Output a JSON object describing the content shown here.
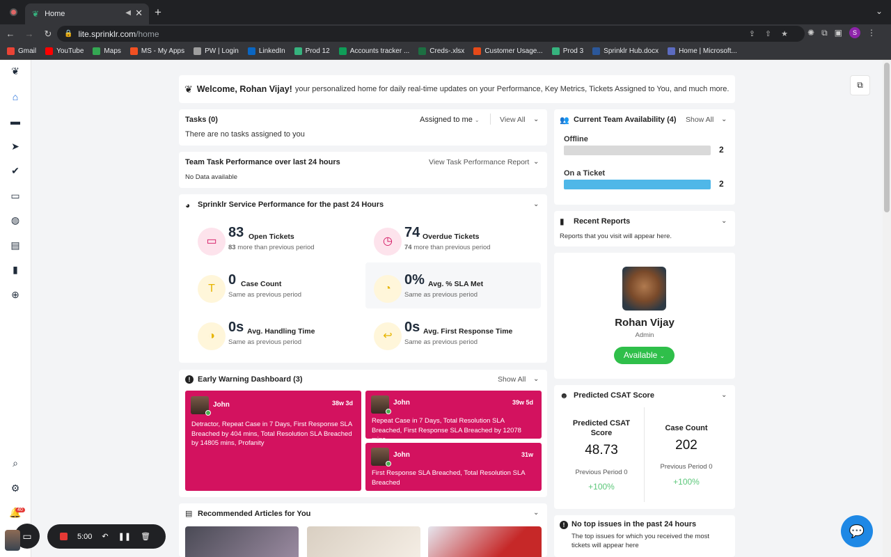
{
  "browser": {
    "tab_title": "Home",
    "url_host": "lite.sprinklr.com",
    "url_path": "/home",
    "profile_initial": "S"
  },
  "bookmarks": [
    {
      "label": "Gmail",
      "color": "#ea4335"
    },
    {
      "label": "YouTube",
      "color": "#ff0000"
    },
    {
      "label": "Maps",
      "color": "#34a853"
    },
    {
      "label": "MS - My Apps",
      "color": "#f25022"
    },
    {
      "label": "PW | Login",
      "color": "#9e9e9e"
    },
    {
      "label": "LinkedIn",
      "color": "#0a66c2"
    },
    {
      "label": "Prod 12",
      "color": "#36b37e"
    },
    {
      "label": "Accounts tracker ...",
      "color": "#0f9d58"
    },
    {
      "label": "Creds-.xlsx",
      "color": "#1d6f42"
    },
    {
      "label": "Customer Usage...",
      "color": "#e64a19"
    },
    {
      "label": "Prod 3",
      "color": "#36b37e"
    },
    {
      "label": "Sprinklr Hub.docx",
      "color": "#2b579a"
    },
    {
      "label": "Home | Microsoft...",
      "color": "#5c6bc0"
    }
  ],
  "welcome": {
    "name": "Welcome, Rohan Vijay!",
    "text": "your personalized home for daily real-time updates on your Performance, Key Metrics, Tickets Assigned to You, and much more."
  },
  "tasks": {
    "title": "Tasks (0)",
    "filter": "Assigned to me",
    "view_all": "View All",
    "empty": "There are no tasks assigned to you"
  },
  "team_task": {
    "title": "Team Task Performance over last 24 hours",
    "report_link": "View Task Performance Report",
    "empty": "No Data available"
  },
  "service": {
    "title": "Sprinklr Service Performance for the past 24 Hours",
    "metrics": [
      {
        "value": "83",
        "label": "Open Tickets",
        "sub_value": "83",
        "sub": "more than previous period"
      },
      {
        "value": "74",
        "label": "Overdue Tickets",
        "sub_value": "74",
        "sub": "more than previous period"
      },
      {
        "value": "0",
        "label": "Case Count",
        "sub": "Same as previous period"
      },
      {
        "value": "0%",
        "label": "Avg. % SLA Met",
        "sub": "Same as previous period"
      },
      {
        "value": "0s",
        "label": "Avg. Handling Time",
        "sub": "Same as previous period"
      },
      {
        "value": "0s",
        "label": "Avg. First Response Time",
        "sub": "Same as previous period"
      }
    ]
  },
  "early_warning": {
    "title": "Early Warning Dashboard (3)",
    "show_all": "Show All",
    "items": [
      {
        "name": "John",
        "age": "38w 3d",
        "text": "Detractor, Repeat Case in 7 Days, First Response SLA Breached by 404 mins, Total Resolution SLA Breached by 14805 mins, Profanity"
      },
      {
        "name": "John",
        "age": "39w 5d",
        "text": "Repeat Case in 7 Days, Total Resolution SLA Breached, First Response SLA Breached by 12078 mins"
      },
      {
        "name": "John",
        "age": "31w",
        "text": "First Response SLA Breached, Total Resolution SLA Breached"
      }
    ]
  },
  "articles": {
    "title": "Recommended Articles for You"
  },
  "availability": {
    "title": "Current Team Availability (4)",
    "show_all": "Show All",
    "rows": [
      {
        "label": "Offline",
        "count": "2",
        "color": "#d9d9d9"
      },
      {
        "label": "On a Ticket",
        "count": "2",
        "color": "#4fb7e8"
      }
    ]
  },
  "recent_reports": {
    "title": "Recent Reports",
    "text": "Reports that you visit will appear here."
  },
  "profile": {
    "name": "Rohan Vijay",
    "role": "Admin",
    "status": "Available",
    "status_color": "#2fbf4a"
  },
  "csat": {
    "title": "Predicted CSAT Score",
    "left_label": "Predicted CSAT Score",
    "left_value": "48.73",
    "left_prev": "Previous Period 0",
    "left_change": "+100%",
    "right_label": "Case Count",
    "right_value": "202",
    "right_prev": "Previous Period 0",
    "right_change": "+100%"
  },
  "top_issues": {
    "title": "No top issues in the past 24 hours",
    "text": "The top issues for which you received the most tickets will appear here"
  },
  "recorder": {
    "time": "5:00"
  },
  "notifications": {
    "count": "40"
  }
}
